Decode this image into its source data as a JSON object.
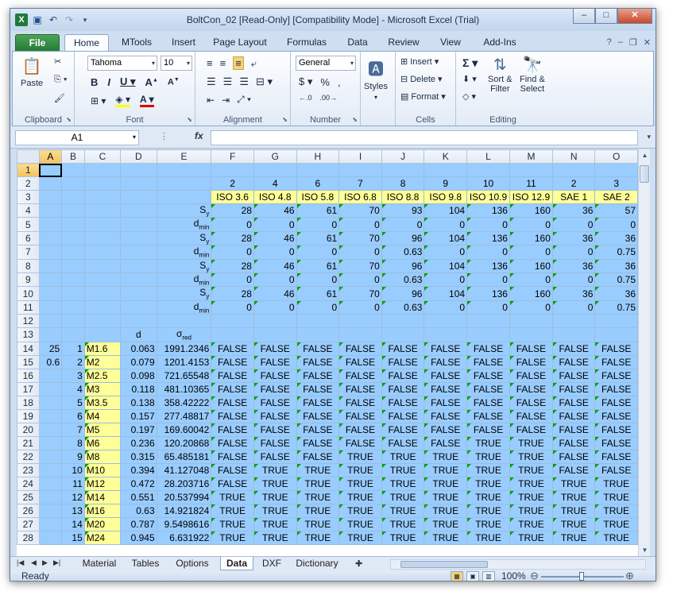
{
  "window": {
    "title": "BoltCon_02  [Read-Only]  [Compatibility Mode]  -  Microsoft Excel (Trial)"
  },
  "tabs": [
    "File",
    "Home",
    "MTools",
    "Insert",
    "Page Layout",
    "Formulas",
    "Data",
    "Review",
    "View",
    "Add-Ins"
  ],
  "ribbon": {
    "clipboard": {
      "paste": "Paste",
      "label": "Clipboard"
    },
    "font": {
      "name": "Tahoma",
      "size": "10",
      "label": "Font"
    },
    "alignment": {
      "label": "Alignment"
    },
    "number": {
      "format": "General",
      "label": "Number"
    },
    "styles": {
      "label": "Styles"
    },
    "cells": {
      "insert": "Insert",
      "delete": "Delete",
      "format": "Format",
      "label": "Cells"
    },
    "editing": {
      "sort": "Sort &",
      "sort2": "Filter",
      "find": "Find &",
      "find2": "Select",
      "label": "Editing"
    }
  },
  "formula_bar": {
    "name_box": "A1",
    "fx": "fx",
    "formula": ""
  },
  "columns": [
    "A",
    "B",
    "C",
    "D",
    "E",
    "F",
    "G",
    "H",
    "I",
    "J",
    "K",
    "L",
    "M",
    "N",
    "O"
  ],
  "rows_header": {
    "r2": [
      "2",
      "4",
      "6",
      "7",
      "8",
      "9",
      "10",
      "11",
      "2",
      "3"
    ],
    "r3": [
      "ISO 3.6",
      "ISO 4.8",
      "ISO 5.8",
      "ISO 6.8",
      "ISO 8.8",
      "ISO 9.8",
      "ISO 10.9",
      "ISO 12.9",
      "SAE 1",
      "SAE 2"
    ],
    "r4": [
      "28",
      "46",
      "61",
      "70",
      "93",
      "104",
      "136",
      "160",
      "36",
      "57"
    ],
    "r5": [
      "0",
      "0",
      "0",
      "0",
      "0",
      "0",
      "0",
      "0",
      "0",
      "0"
    ],
    "r6": [
      "28",
      "46",
      "61",
      "70",
      "96",
      "104",
      "136",
      "160",
      "36",
      "36"
    ],
    "r7": [
      "0",
      "0",
      "0",
      "0",
      "0.63",
      "0",
      "0",
      "0",
      "0",
      "0.75"
    ],
    "r8": [
      "28",
      "46",
      "61",
      "70",
      "96",
      "104",
      "136",
      "160",
      "36",
      "36"
    ],
    "r9": [
      "0",
      "0",
      "0",
      "0",
      "0.63",
      "0",
      "0",
      "0",
      "0",
      "0.75"
    ],
    "r10": [
      "28",
      "46",
      "61",
      "70",
      "96",
      "104",
      "136",
      "160",
      "36",
      "36"
    ],
    "r11": [
      "0",
      "0",
      "0",
      "0",
      "0.63",
      "0",
      "0",
      "0",
      "0",
      "0.75"
    ]
  },
  "labels": {
    "sy": "S",
    "sy_sub": "y",
    "dmin": "d",
    "dmin_sub": "min",
    "d": "d",
    "sred": "σ",
    "sred_sub": "red"
  },
  "side": {
    "a14": "25",
    "a15": "0.6"
  },
  "bolt_rows": [
    {
      "row": "14",
      "n": "1",
      "name": "M1.6",
      "d": "0.063",
      "s": "1991.2346",
      "v": [
        "FALSE",
        "FALSE",
        "FALSE",
        "FALSE",
        "FALSE",
        "FALSE",
        "FALSE",
        "FALSE",
        "FALSE",
        "FALSE"
      ]
    },
    {
      "row": "15",
      "n": "2",
      "name": "M2",
      "d": "0.079",
      "s": "1201.4153",
      "v": [
        "FALSE",
        "FALSE",
        "FALSE",
        "FALSE",
        "FALSE",
        "FALSE",
        "FALSE",
        "FALSE",
        "FALSE",
        "FALSE"
      ]
    },
    {
      "row": "16",
      "n": "3",
      "name": "M2.5",
      "d": "0.098",
      "s": "721.65548",
      "v": [
        "FALSE",
        "FALSE",
        "FALSE",
        "FALSE",
        "FALSE",
        "FALSE",
        "FALSE",
        "FALSE",
        "FALSE",
        "FALSE"
      ]
    },
    {
      "row": "17",
      "n": "4",
      "name": "M3",
      "d": "0.118",
      "s": "481.10365",
      "v": [
        "FALSE",
        "FALSE",
        "FALSE",
        "FALSE",
        "FALSE",
        "FALSE",
        "FALSE",
        "FALSE",
        "FALSE",
        "FALSE"
      ]
    },
    {
      "row": "18",
      "n": "5",
      "name": "M3.5",
      "d": "0.138",
      "s": "358.42222",
      "v": [
        "FALSE",
        "FALSE",
        "FALSE",
        "FALSE",
        "FALSE",
        "FALSE",
        "FALSE",
        "FALSE",
        "FALSE",
        "FALSE"
      ]
    },
    {
      "row": "19",
      "n": "6",
      "name": "M4",
      "d": "0.157",
      "s": "277.48817",
      "v": [
        "FALSE",
        "FALSE",
        "FALSE",
        "FALSE",
        "FALSE",
        "FALSE",
        "FALSE",
        "FALSE",
        "FALSE",
        "FALSE"
      ]
    },
    {
      "row": "20",
      "n": "7",
      "name": "M5",
      "d": "0.197",
      "s": "169.60042",
      "v": [
        "FALSE",
        "FALSE",
        "FALSE",
        "FALSE",
        "FALSE",
        "FALSE",
        "FALSE",
        "FALSE",
        "FALSE",
        "FALSE"
      ]
    },
    {
      "row": "21",
      "n": "8",
      "name": "M6",
      "d": "0.236",
      "s": "120.20868",
      "v": [
        "FALSE",
        "FALSE",
        "FALSE",
        "FALSE",
        "FALSE",
        "FALSE",
        "TRUE",
        "TRUE",
        "FALSE",
        "FALSE"
      ]
    },
    {
      "row": "22",
      "n": "9",
      "name": "M8",
      "d": "0.315",
      "s": "65.485181",
      "v": [
        "FALSE",
        "FALSE",
        "FALSE",
        "TRUE",
        "TRUE",
        "TRUE",
        "TRUE",
        "TRUE",
        "FALSE",
        "FALSE"
      ]
    },
    {
      "row": "23",
      "n": "10",
      "name": "M10",
      "d": "0.394",
      "s": "41.127048",
      "v": [
        "FALSE",
        "TRUE",
        "TRUE",
        "TRUE",
        "TRUE",
        "TRUE",
        "TRUE",
        "TRUE",
        "FALSE",
        "FALSE"
      ]
    },
    {
      "row": "24",
      "n": "11",
      "name": "M12",
      "d": "0.472",
      "s": "28.203716",
      "v": [
        "FALSE",
        "TRUE",
        "TRUE",
        "TRUE",
        "TRUE",
        "TRUE",
        "TRUE",
        "TRUE",
        "TRUE",
        "TRUE"
      ]
    },
    {
      "row": "25",
      "n": "12",
      "name": "M14",
      "d": "0.551",
      "s": "20.537994",
      "v": [
        "TRUE",
        "TRUE",
        "TRUE",
        "TRUE",
        "TRUE",
        "TRUE",
        "TRUE",
        "TRUE",
        "TRUE",
        "TRUE"
      ]
    },
    {
      "row": "26",
      "n": "13",
      "name": "M16",
      "d": "0.63",
      "s": "14.921824",
      "v": [
        "TRUE",
        "TRUE",
        "TRUE",
        "TRUE",
        "TRUE",
        "TRUE",
        "TRUE",
        "TRUE",
        "TRUE",
        "TRUE"
      ]
    },
    {
      "row": "27",
      "n": "14",
      "name": "M20",
      "d": "0.787",
      "s": "9.5498616",
      "v": [
        "TRUE",
        "TRUE",
        "TRUE",
        "TRUE",
        "TRUE",
        "TRUE",
        "TRUE",
        "TRUE",
        "TRUE",
        "TRUE"
      ]
    },
    {
      "row": "28",
      "n": "15",
      "name": "M24",
      "d": "0.945",
      "s": "6.631922",
      "v": [
        "TRUE",
        "TRUE",
        "TRUE",
        "TRUE",
        "TRUE",
        "TRUE",
        "TRUE",
        "TRUE",
        "TRUE",
        "TRUE"
      ]
    }
  ],
  "sheets": [
    "Material",
    "Tables",
    "Options",
    "Data",
    "DXF",
    "Dictionary"
  ],
  "active_sheet": "Data",
  "status": {
    "ready": "Ready",
    "zoom": "100%"
  }
}
